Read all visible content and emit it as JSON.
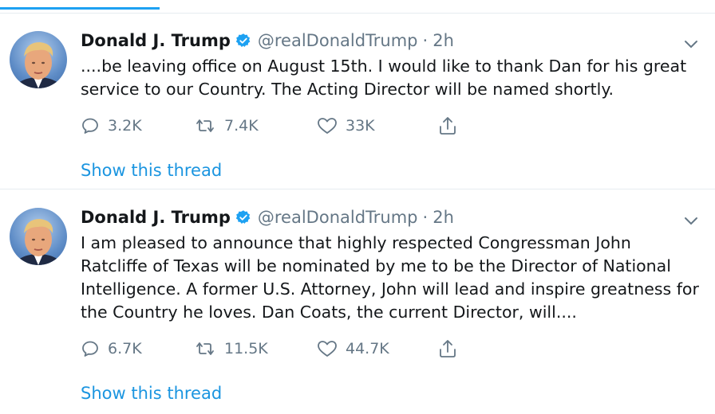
{
  "tweets": [
    {
      "author_name": "Donald J. Trump",
      "handle": "@realDonaldTrump",
      "separator": "·",
      "time": "2h",
      "text": "....be leaving office on August 15th. I would like to thank Dan for his great service to our Country. The Acting Director will be named shortly.",
      "replies": "3.2K",
      "retweets": "7.4K",
      "likes": "33K",
      "thread_link": "Show this thread"
    },
    {
      "author_name": "Donald J. Trump",
      "handle": "@realDonaldTrump",
      "separator": "·",
      "time": "2h",
      "text": "I am pleased to announce that highly respected Congressman John Ratcliffe of Texas will be nominated by me to be the Director of National Intelligence. A former U.S. Attorney, John will lead and inspire greatness for the Country he loves. Dan Coats, the current Director, will....",
      "replies": "6.7K",
      "retweets": "11.5K",
      "likes": "44.7K",
      "thread_link": "Show this thread"
    }
  ],
  "icons": {
    "verified": "verified-badge-icon",
    "more": "chevron-down-icon",
    "reply": "reply-icon",
    "retweet": "retweet-icon",
    "like": "heart-icon",
    "share": "share-icon"
  },
  "colors": {
    "link": "#1b95e0",
    "verified": "#1da1f2",
    "muted": "#657786"
  }
}
